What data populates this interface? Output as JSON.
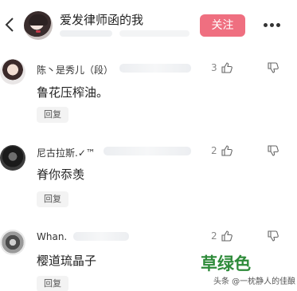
{
  "header": {
    "title": "爱发律师函的我",
    "follow_label": "关注"
  },
  "comments": [
    {
      "username": "陈丶是秀儿（段）",
      "content": "鲁花压榨油。",
      "likes": "3",
      "reply_label": "回复"
    },
    {
      "username": "尼古拉斯.✓™",
      "content": "脊你忝羡",
      "likes": "2",
      "reply_label": "回复"
    },
    {
      "username": "Whan.",
      "content": "樱道琉晶子",
      "likes": "2",
      "reply_label": "回复"
    }
  ],
  "overlay": {
    "text": "草绿色",
    "watermark": "头条 @一枕静人的佳酿"
  },
  "colors": {
    "follow_button": "#ef6f80",
    "overlay_text": "#2e8b3a"
  }
}
